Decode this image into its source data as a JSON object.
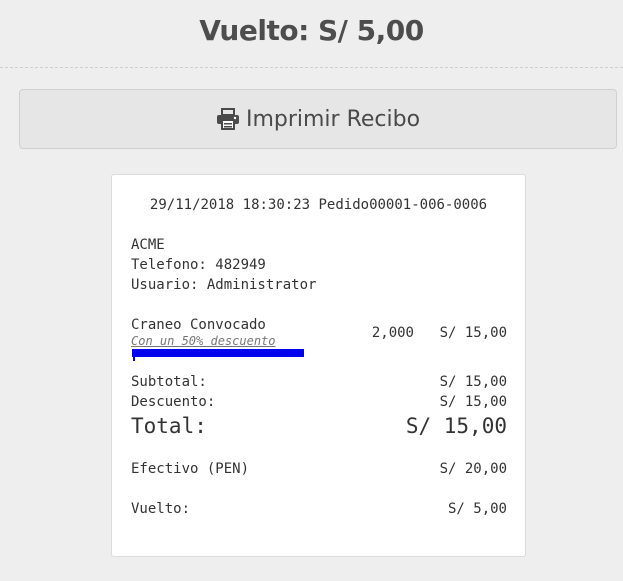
{
  "header": {
    "change_title": "Vuelto: S/ 5,00"
  },
  "print_button": {
    "label": "Imprimir Recibo",
    "icon": "print-icon"
  },
  "receipt": {
    "date_line": "29/11/2018 18:30:23 Pedido00001-006-0006",
    "company": "ACME",
    "phone": "Telefono: 482949",
    "user": "Usuario: Administrator",
    "item": {
      "name": "Craneo Convocado",
      "note": "Con un 50% descuento",
      "quantity": "2,000",
      "price": "S/ 15,00"
    },
    "subtotal_label": "Subtotal:",
    "subtotal_value": "S/ 15,00",
    "discount_label": "Descuento:",
    "discount_value": "S/ 15,00",
    "total_label": "Total:",
    "total_value": "S/ 15,00",
    "cash_label": "Efectivo (PEN)",
    "cash_value": "S/ 20,00",
    "change_label": "Vuelto:",
    "change_value": "S/ 5,00"
  },
  "colors": {
    "highlight": "#0000ee",
    "background": "#efeeee"
  }
}
